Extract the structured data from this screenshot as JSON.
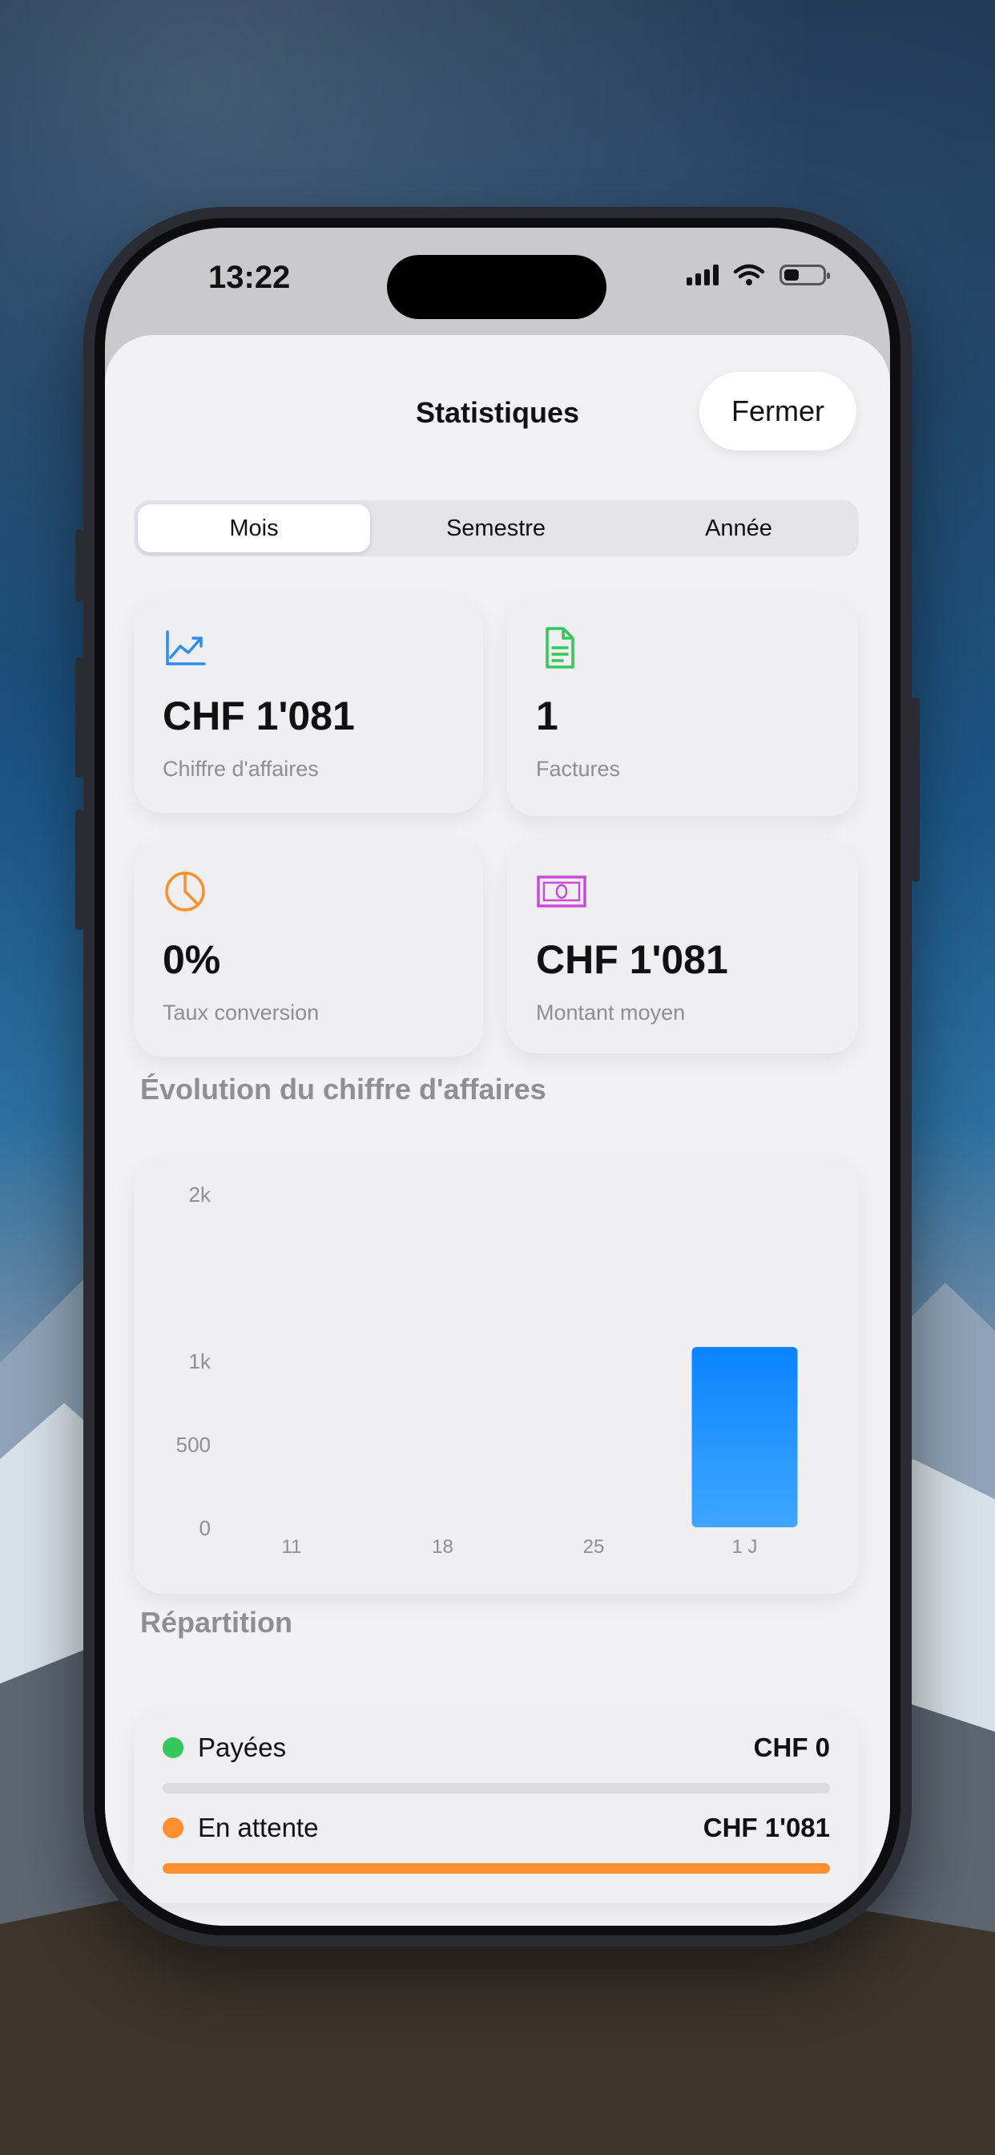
{
  "status_bar": {
    "time": "13:22"
  },
  "sheet": {
    "title": "Statistiques",
    "close_label": "Fermer"
  },
  "period_tabs": [
    {
      "label": "Mois",
      "selected": true
    },
    {
      "label": "Semestre",
      "selected": false
    },
    {
      "label": "Année",
      "selected": false
    }
  ],
  "stats": [
    {
      "icon": "chart-line-up-icon",
      "value": "CHF 1'081",
      "label": "Chiffre d'affaires",
      "color": "#2f8cf0"
    },
    {
      "icon": "document-icon",
      "value": "1",
      "label": "Factures",
      "color": "#34c759"
    },
    {
      "icon": "pie-chart-icon",
      "value": "0%",
      "label": "Taux conversion",
      "color": "#ff8f2e"
    },
    {
      "icon": "banknote-icon",
      "value": "CHF 1'081",
      "label": "Montant moyen",
      "color": "#c94bd6"
    }
  ],
  "revenue_section": {
    "title": "Évolution du chiffre d'affaires"
  },
  "chart_data": {
    "type": "bar",
    "categories": [
      "11",
      "18",
      "25",
      "1 J"
    ],
    "values": [
      0,
      0,
      0,
      1081
    ],
    "yticks": [
      "0",
      "500",
      "1k",
      "2k"
    ],
    "ylim": [
      0,
      2000
    ],
    "grid": false,
    "bar_color": "#1e90ff"
  },
  "breakdown": {
    "title": "Répartition",
    "items": [
      {
        "label": "Payées",
        "amount": "CHF 0",
        "color": "#34c759",
        "fraction": 0
      },
      {
        "label": "En attente",
        "amount": "CHF 1'081",
        "color": "#ff8f2e",
        "fraction": 1
      }
    ]
  }
}
